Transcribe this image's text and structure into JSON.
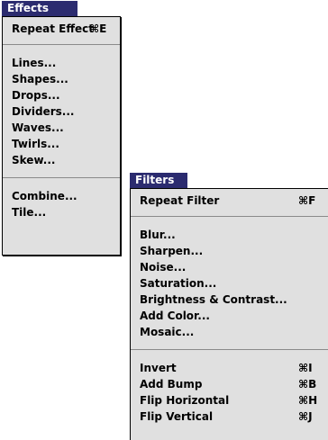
{
  "effects_menu": {
    "title": "Effects",
    "items": [
      {
        "label": "Repeat Effect",
        "shortcut": "⌘E"
      },
      {
        "label": "Lines..."
      },
      {
        "label": "Shapes..."
      },
      {
        "label": "Drops..."
      },
      {
        "label": "Dividers..."
      },
      {
        "label": "Waves..."
      },
      {
        "label": "Twirls..."
      },
      {
        "label": "Skew..."
      },
      {
        "label": "Combine..."
      },
      {
        "label": "Tile..."
      }
    ]
  },
  "filters_menu": {
    "title": "Filters",
    "items": [
      {
        "label": "Repeat Filter",
        "shortcut": "⌘F"
      },
      {
        "label": "Blur..."
      },
      {
        "label": "Sharpen..."
      },
      {
        "label": "Noise..."
      },
      {
        "label": "Saturation..."
      },
      {
        "label": "Brightness & Contrast..."
      },
      {
        "label": "Add Color..."
      },
      {
        "label": "Mosaic..."
      },
      {
        "label": "Invert",
        "shortcut": "⌘I"
      },
      {
        "label": "Add Bump",
        "shortcut": "⌘B"
      },
      {
        "label": "Flip Horizontal",
        "shortcut": "⌘H"
      },
      {
        "label": "Flip Vertical",
        "shortcut": "⌘J"
      }
    ]
  },
  "colors": {
    "title_highlight": "#2b2b6f",
    "menu_background": "#e0e0e0",
    "separator": "#8a8a8a"
  }
}
